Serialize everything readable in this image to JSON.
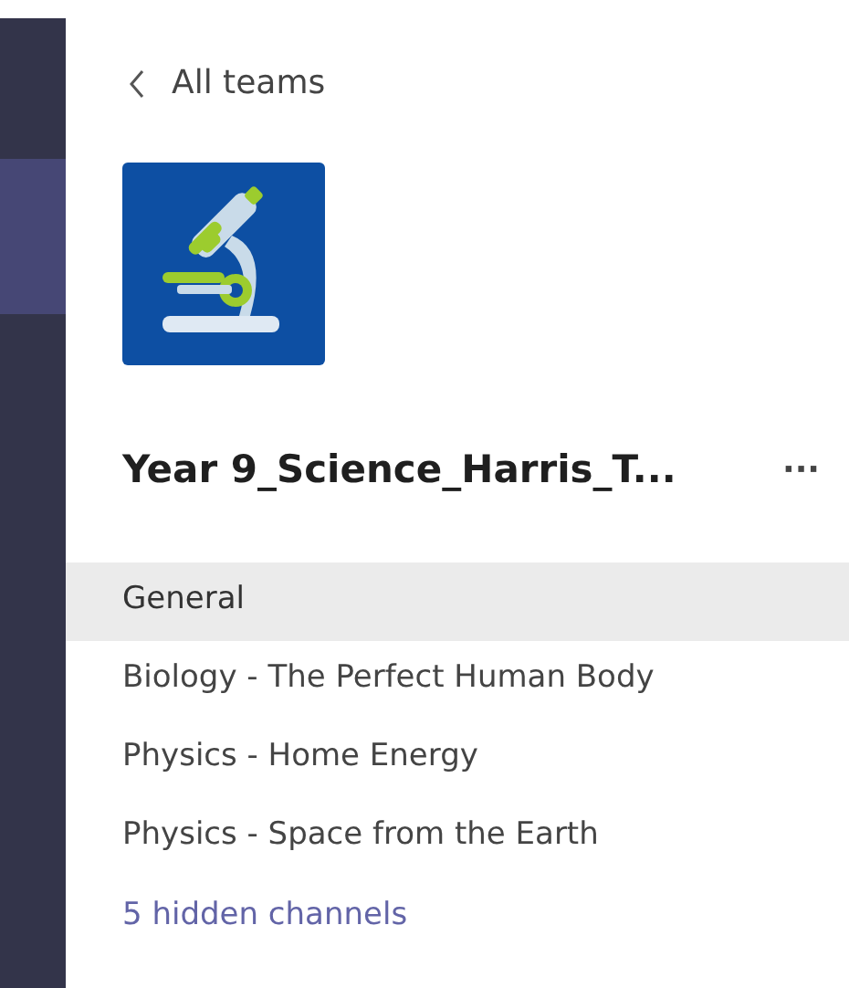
{
  "back_link": {
    "label": "All teams"
  },
  "team": {
    "name": "Year 9_Science_Harris_T...",
    "more": "···"
  },
  "channels": [
    {
      "name": "General",
      "selected": true
    },
    {
      "name": "Biology - The Perfect Human Body",
      "selected": false
    },
    {
      "name": "Physics - Home Energy",
      "selected": false
    },
    {
      "name": "Physics - Space from the Earth",
      "selected": false
    }
  ],
  "hidden_channels": {
    "label": "5 hidden channels"
  }
}
